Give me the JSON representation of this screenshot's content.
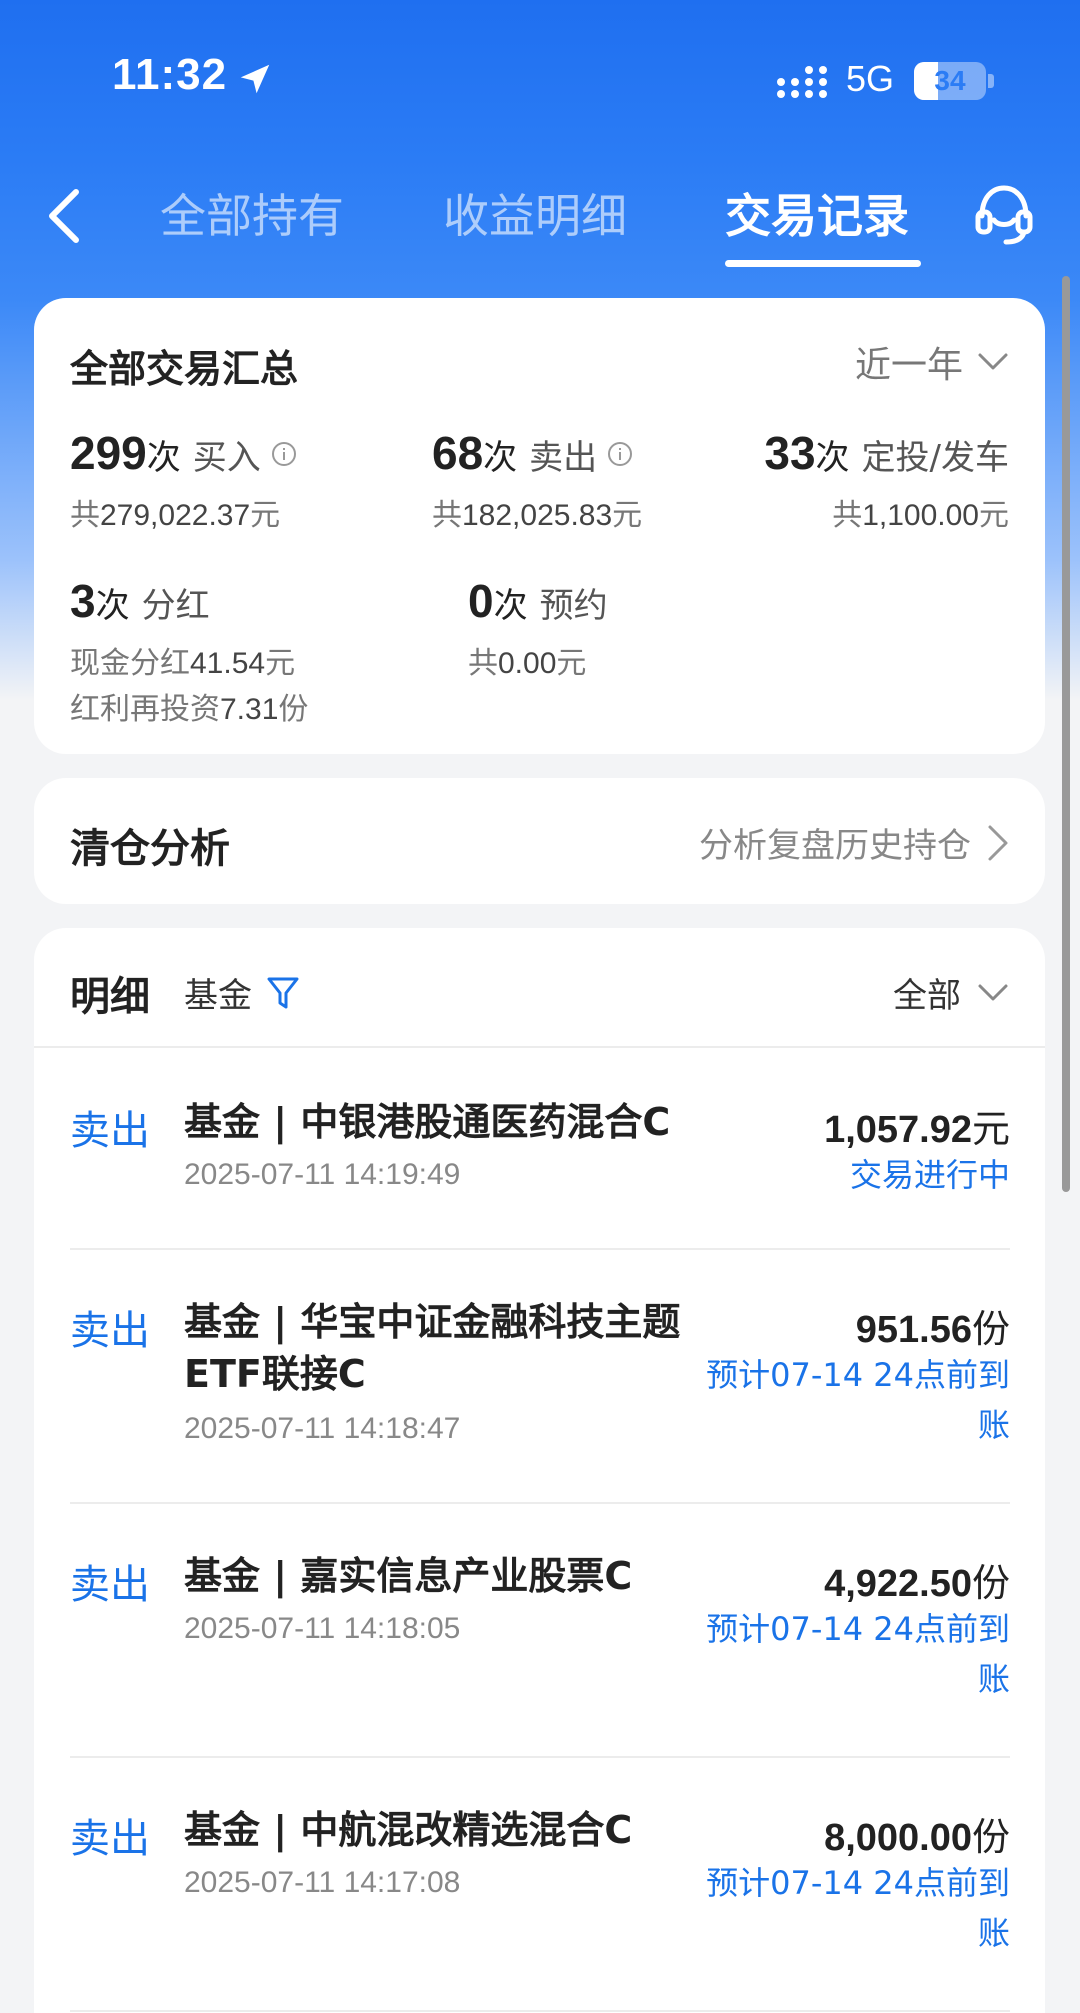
{
  "status_bar": {
    "time": "11:32",
    "network": "5G",
    "battery": "34",
    "battery_level": 0.34
  },
  "nav": {
    "tabs": [
      "全部持有",
      "收益明细",
      "交易记录"
    ],
    "active_tab": 2
  },
  "summary": {
    "title": "全部交易汇总",
    "period": "近一年",
    "buy": {
      "count": "299",
      "unit": "次",
      "label": "买入",
      "sub_prefix": "共",
      "sub_value": "279,022.37",
      "sub_suffix": "元"
    },
    "sell": {
      "count": "68",
      "unit": "次",
      "label": "卖出",
      "sub_prefix": "共",
      "sub_value": "182,025.83",
      "sub_suffix": "元"
    },
    "dca": {
      "count": "33",
      "unit": "次",
      "label": "定投/发车",
      "sub_prefix": "共",
      "sub_value": "1,100.00",
      "sub_suffix": "元"
    },
    "dividend": {
      "count": "3",
      "unit": "次",
      "label": "分红",
      "cash_prefix": "现金分红",
      "cash_value": "41.54",
      "cash_suffix": "元",
      "reinvest_prefix": "红利再投资",
      "reinvest_value": "7.31",
      "reinvest_suffix": "份"
    },
    "reserve": {
      "count": "0",
      "unit": "次",
      "label": "预约",
      "sub_prefix": "共",
      "sub_value": "0.00",
      "sub_suffix": "元"
    }
  },
  "clear_analysis": {
    "title": "清仓分析",
    "link": "分析复盘历史持仓"
  },
  "detail": {
    "title": "明细",
    "filter": "基金",
    "scope": "全部",
    "rows": [
      {
        "type": "卖出",
        "name": "基金 | 中银港股通医药混合C",
        "time": "2025-07-11 14:19:49",
        "amount": "1,057.92",
        "amount_unit": "元",
        "status": "交易进行中"
      },
      {
        "type": "卖出",
        "name": "基金 | 华宝中证金融科技主题ETF联接C",
        "time": "2025-07-11 14:18:47",
        "amount": "951.56",
        "amount_unit": "份",
        "status": "预计07-14 24点前到账"
      },
      {
        "type": "卖出",
        "name": "基金 | 嘉实信息产业股票C",
        "time": "2025-07-11 14:18:05",
        "amount": "4,922.50",
        "amount_unit": "份",
        "status": "预计07-14 24点前到账"
      },
      {
        "type": "卖出",
        "name": "基金 | 中航混改精选混合C",
        "time": "2025-07-11 14:17:08",
        "amount": "8,000.00",
        "amount_unit": "份",
        "status": "预计07-14 24点前到账"
      }
    ]
  },
  "icons": {
    "location": "location-arrow-icon",
    "signal": "signal-icon",
    "back": "chevron-left-icon",
    "service": "headset-service-icon",
    "period_dropdown": "chevron-down-icon",
    "info": "info-icon",
    "filter": "filter-icon",
    "link_arrow": "chevron-right-icon"
  },
  "colors": {
    "brand_blue": "#2b7cf5",
    "link_blue": "#1a73e8"
  }
}
